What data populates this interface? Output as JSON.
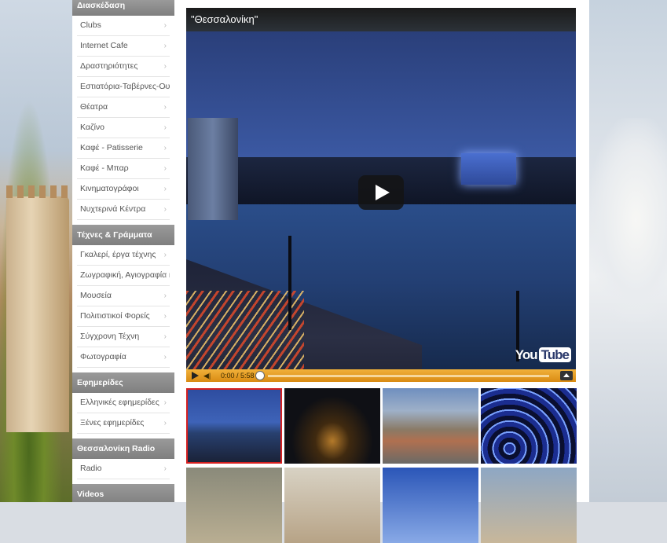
{
  "sidebar": {
    "top_header": "Διασκέδαση",
    "entertainment_items": [
      {
        "label": "Clubs"
      },
      {
        "label": "Internet Cafe"
      },
      {
        "label": "Δραστηριότητες"
      },
      {
        "label": "Εστιατόρια-Ταβέρνες-Ουζερί"
      },
      {
        "label": "Θέατρα"
      },
      {
        "label": "Καζίνο"
      },
      {
        "label": "Καφέ - Patisserie"
      },
      {
        "label": "Καφέ - Μπαρ"
      },
      {
        "label": "Κινηματογράφοι"
      },
      {
        "label": "Νυχτερινά Κέντρα"
      }
    ],
    "arts_header": "Τέχνες & Γράμματα",
    "arts_items": [
      {
        "label": "Γκαλερί, έργα τέχνης"
      },
      {
        "label": "Ζωγραφική, Αγιογραφία κ.α"
      },
      {
        "label": "Μουσεία"
      },
      {
        "label": "Πολιτιστικοί Φορείς"
      },
      {
        "label": "Σύγχρονη Τέχνη"
      },
      {
        "label": "Φωτογραφία"
      }
    ],
    "news_header": "Εφημερίδες",
    "news_items": [
      {
        "label": "Ελληνικές εφημερίδες"
      },
      {
        "label": "Ξένες εφημερίδες"
      }
    ],
    "radio_header": "Θεσσαλονίκη Radio",
    "radio_items": [
      {
        "label": "Radio"
      }
    ],
    "videos_header": "Videos",
    "arrow_glyph": "›"
  },
  "player": {
    "title": "\"Θεσσαλονίκη\"",
    "time": "0:00 / 5:58",
    "volume_glyph": "◀|",
    "logo_you": "You",
    "logo_tube": "Tube",
    "progress": 0.0
  },
  "thumbnails": [
    {
      "selected": true
    },
    {
      "selected": false
    },
    {
      "selected": false
    },
    {
      "selected": false
    },
    {
      "selected": false
    },
    {
      "selected": false
    },
    {
      "selected": false
    },
    {
      "selected": false
    }
  ],
  "colors": {
    "control_bar": "#e9a027",
    "section_header": "#8c8c8c",
    "selected_border": "#d52020"
  }
}
